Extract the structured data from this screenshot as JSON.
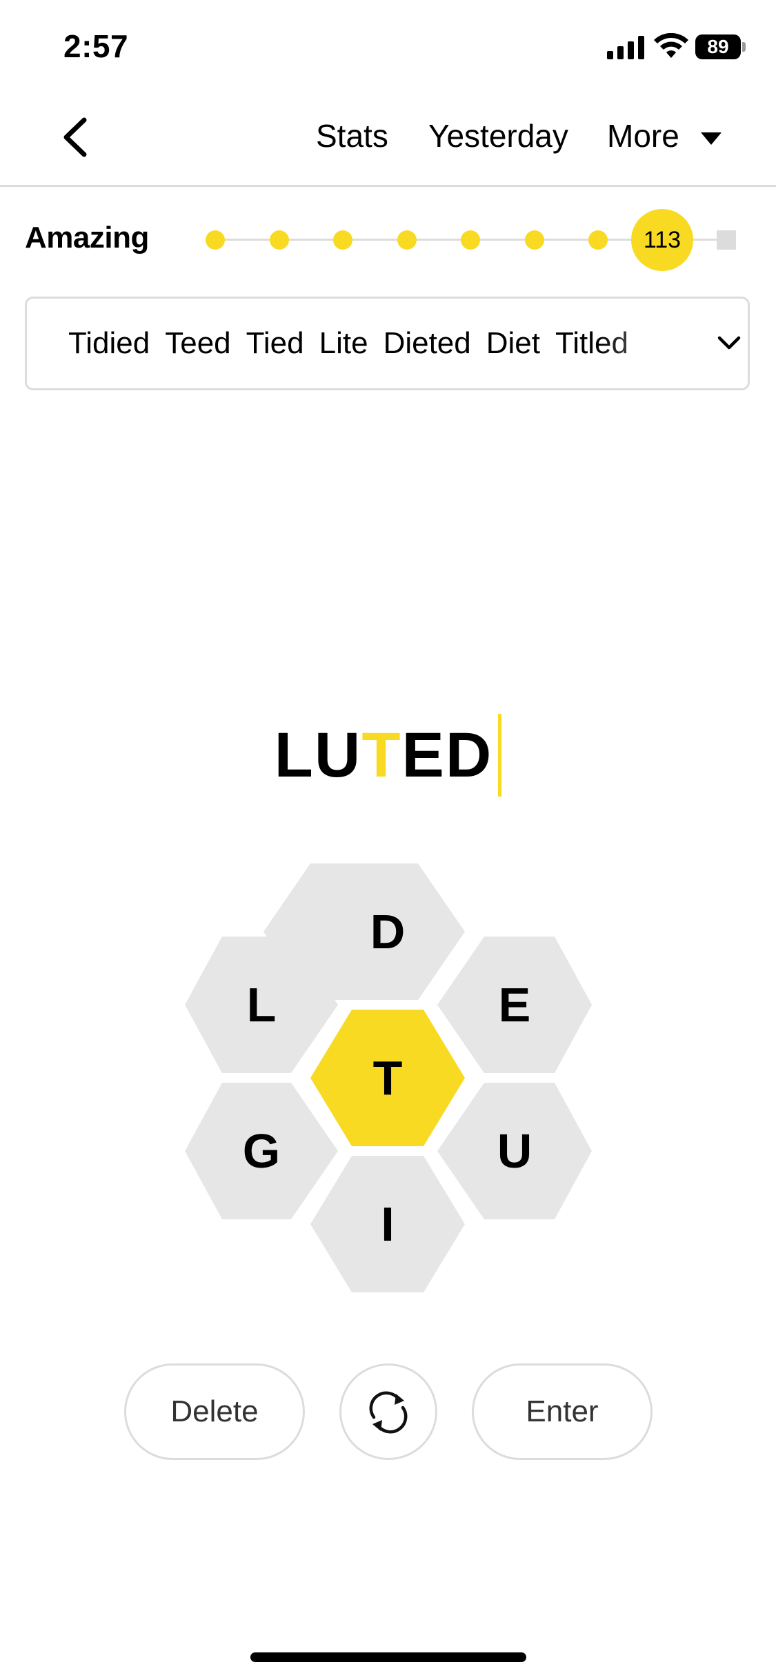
{
  "status_bar": {
    "time": "2:57",
    "battery_level": "89"
  },
  "nav": {
    "stats_label": "Stats",
    "yesterday_label": "Yesterday",
    "more_label": "More"
  },
  "progress": {
    "rank": "Amazing",
    "score": "113",
    "levels_total": 9,
    "current_level": 8
  },
  "found_words": [
    "Tidied",
    "Teed",
    "Tied",
    "Lite",
    "Dieted",
    "Diet",
    "Titled"
  ],
  "current_word": {
    "before": "LU",
    "center": "T",
    "after": "ED"
  },
  "hive": {
    "center_letter": "T",
    "outer_letters": {
      "top": "D",
      "upper_left": "L",
      "upper_right": "E",
      "lower_left": "G",
      "lower_right": "U",
      "bottom": "I"
    }
  },
  "controls": {
    "delete_label": "Delete",
    "enter_label": "Enter"
  },
  "colors": {
    "accent": "#f7da21",
    "cell": "#e6e6e6",
    "border": "#dcdcdc"
  },
  "icons": {
    "back": "chevron-left-icon",
    "more": "caret-down-icon",
    "expand": "chevron-down-icon",
    "shuffle": "shuffle-icon"
  }
}
